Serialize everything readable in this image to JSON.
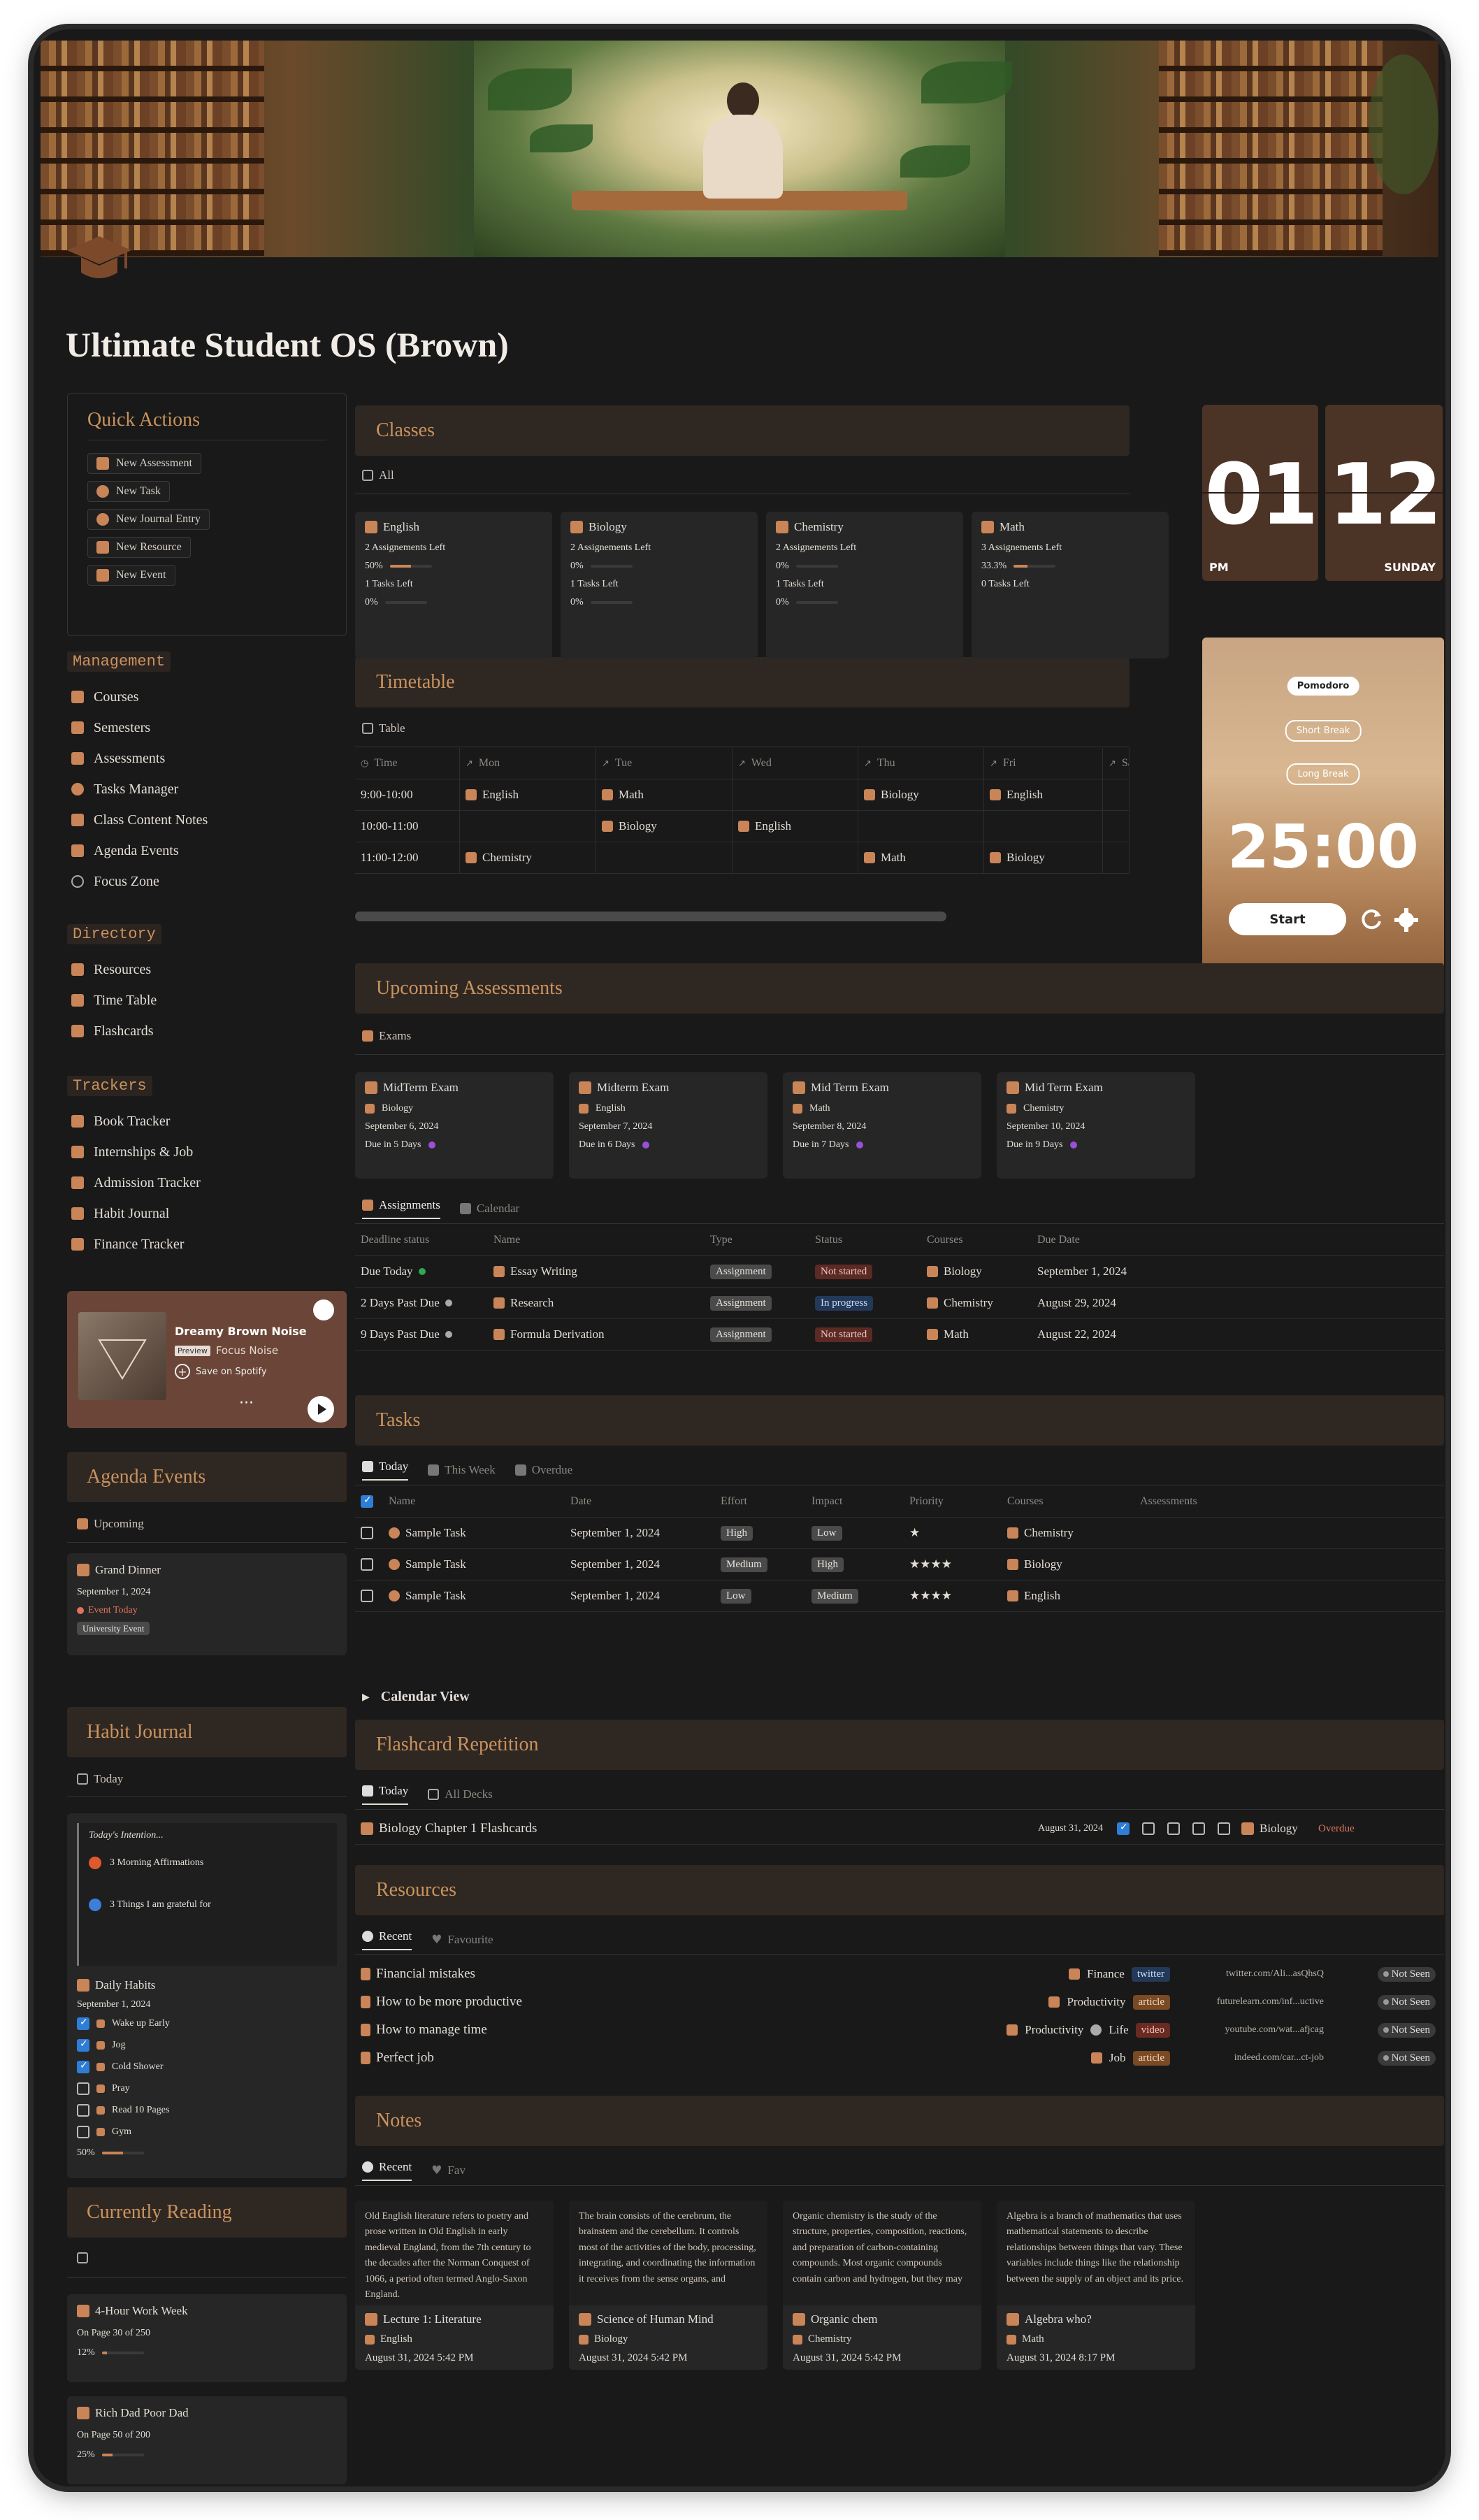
{
  "page_title": "Ultimate Student OS (Brown)",
  "quick_actions": {
    "title": "Quick Actions",
    "items": [
      "New Assessment",
      "New Task",
      "New Journal Entry",
      "New Resource",
      "New Event"
    ]
  },
  "management": {
    "title": "Management",
    "items": [
      "Courses",
      "Semesters",
      "Assessments",
      "Tasks Manager",
      "Class Content Notes",
      "Agenda Events",
      "Focus Zone"
    ]
  },
  "directory": {
    "title": "Directory",
    "items": [
      "Resources",
      "Time Table",
      "Flashcards"
    ]
  },
  "trackers": {
    "title": "Trackers",
    "items": [
      "Book Tracker",
      "Internships & Job",
      "Admission Tracker",
      "Habit Journal",
      "Finance Tracker"
    ]
  },
  "spotify": {
    "title": "Dreamy Brown Noise",
    "preview": "Preview",
    "subtitle": "Focus Noise",
    "save": "Save on Spotify",
    "more": "···"
  },
  "agenda": {
    "title": "Agenda Events",
    "view": "Upcoming",
    "event": {
      "name": "Grand Dinner",
      "date": "September 1, 2024",
      "status": "Event Today",
      "tag": "University Event"
    }
  },
  "habit": {
    "title": "Habit Journal",
    "view": "Today",
    "intention_title": "Today's Intention...",
    "intentions": [
      "3 Morning Affirmations",
      "3 Things I am grateful for"
    ],
    "daily_title": "Daily Habits",
    "date": "September 1, 2024",
    "items": [
      {
        "label": "Wake up Early",
        "done": true
      },
      {
        "label": "Jog",
        "done": true
      },
      {
        "label": "Cold Shower",
        "done": true
      },
      {
        "label": "Pray",
        "done": false
      },
      {
        "label": "Read 10 Pages",
        "done": false
      },
      {
        "label": "Gym",
        "done": false
      }
    ],
    "progress": "50%"
  },
  "reading": {
    "title": "Currently Reading",
    "books": [
      {
        "title": "4-Hour Work Week",
        "page": "On Page 30 of 250",
        "pct": "12%",
        "fill": 0.12
      },
      {
        "title": "Rich Dad Poor Dad",
        "page": "On Page 50 of 200",
        "pct": "25%",
        "fill": 0.25
      }
    ]
  },
  "classes": {
    "title": "Classes",
    "view": "All",
    "cards": [
      {
        "name": "English",
        "assign": "2 Assignements Left",
        "apct": "50%",
        "afill": 0.5,
        "tasks": "1 Tasks Left",
        "tpct": "0%"
      },
      {
        "name": "Biology",
        "assign": "2 Assignements Left",
        "apct": "0%",
        "afill": 0,
        "tasks": "1 Tasks Left",
        "tpct": "0%"
      },
      {
        "name": "Chemistry",
        "assign": "2 Assignements Left",
        "apct": "0%",
        "afill": 0,
        "tasks": "1 Tasks Left",
        "tpct": "0%"
      },
      {
        "name": "Math",
        "assign": "3 Assignements Left",
        "apct": "33.3%",
        "afill": 0.333,
        "tasks": "0 Tasks Left",
        "tpct": ""
      }
    ]
  },
  "clock": {
    "hour": "01",
    "minute": "12",
    "ampm": "PM",
    "day": "SUNDAY"
  },
  "pomodoro": {
    "modes": [
      "Pomodoro",
      "Short Break",
      "Long Break"
    ],
    "time": "25:00",
    "start": "Start"
  },
  "timetable": {
    "title": "Timetable",
    "view": "Table",
    "columns": [
      "Time",
      "Mon",
      "Tue",
      "Wed",
      "Thu",
      "Fri",
      "Sa"
    ],
    "rows": [
      [
        "9:00-10:00",
        "English",
        "Math",
        "",
        "Biology",
        "English",
        ""
      ],
      [
        "10:00-11:00",
        "",
        "Biology",
        "English",
        "",
        "",
        ""
      ],
      [
        "11:00-12:00",
        "Chemistry",
        "",
        "",
        "Math",
        "Biology",
        ""
      ]
    ]
  },
  "assessments": {
    "title": "Upcoming Assessments",
    "view": "Exams",
    "exams": [
      {
        "name": "MidTerm Exam",
        "course": "Biology",
        "date": "September 6, 2024",
        "due": "Due in 5 Days"
      },
      {
        "name": "Midterm Exam",
        "course": "English",
        "date": "September 7, 2024",
        "due": "Due in 6 Days"
      },
      {
        "name": "Mid Term Exam",
        "course": "Math",
        "date": "September 8, 2024",
        "due": "Due in 7 Days"
      },
      {
        "name": "Mid Term Exam",
        "course": "Chemistry",
        "date": "September 10, 2024",
        "due": "Due in 9 Days"
      }
    ],
    "tabs": [
      "Assignments",
      "Calendar"
    ],
    "columns": [
      "Deadline status",
      "Name",
      "Type",
      "Status",
      "Courses",
      "Due Date"
    ],
    "rows": [
      {
        "deadline": "Due Today",
        "name": "Essay Writing",
        "type": "Assignment",
        "status": "Not started",
        "course": "Biology",
        "due": "September 1, 2024"
      },
      {
        "deadline": "2 Days Past Due",
        "name": "Research",
        "type": "Assignment",
        "status": "In progress",
        "course": "Chemistry",
        "due": "August 29, 2024"
      },
      {
        "deadline": "9 Days Past Due",
        "name": "Formula Derivation",
        "type": "Assignment",
        "status": "Not started",
        "course": "Math",
        "due": "August 22, 2024"
      }
    ]
  },
  "tasks": {
    "title": "Tasks",
    "tabs": [
      "Today",
      "This Week",
      "Overdue"
    ],
    "columns": [
      "Name",
      "Date",
      "Effort",
      "Impact",
      "Priority",
      "Courses",
      "Assessments"
    ],
    "rows": [
      {
        "name": "Sample Task",
        "date": "September 1, 2024",
        "effort": "High",
        "impact": "Low",
        "priority": "★",
        "course": "Chemistry"
      },
      {
        "name": "Sample Task",
        "date": "September 1, 2024",
        "effort": "Medium",
        "impact": "High",
        "priority": "★★★★",
        "course": "Biology"
      },
      {
        "name": "Sample Task",
        "date": "September 1, 2024",
        "effort": "Low",
        "impact": "Medium",
        "priority": "★★★★",
        "course": "English"
      }
    ],
    "calendar_toggle": "Calendar View"
  },
  "flashcards": {
    "title": "Flashcard Repetition",
    "tabs": [
      "Today",
      "All Decks"
    ],
    "row": {
      "name": "Biology Chapter 1 Flashcards",
      "date": "August 31, 2024",
      "course": "Biology",
      "status": "Overdue"
    }
  },
  "resources": {
    "title": "Resources",
    "tabs": [
      "Recent",
      "Favourite"
    ],
    "rows": [
      {
        "name": "Financial mistakes",
        "cat": "Finance",
        "type": "twitter",
        "url": "twitter.com/Ali...asQhsQ",
        "status": "Not Seen"
      },
      {
        "name": "How to be more productive",
        "cat": "Productivity",
        "type": "article",
        "url": "futurelearn.com/inf...uctive",
        "status": "Not Seen"
      },
      {
        "name": "How to manage time",
        "cat": "Productivity",
        "cat2": "Life",
        "type": "video",
        "url": "youtube.com/wat...afjcag",
        "status": "Not Seen"
      },
      {
        "name": "Perfect job",
        "cat": "Job",
        "type": "article",
        "url": "indeed.com/car...ct-job",
        "status": "Not Seen"
      }
    ]
  },
  "notes": {
    "title": "Notes",
    "tabs": [
      "Recent",
      "Fav"
    ],
    "cards": [
      {
        "preview": "Old English literature refers to poetry and prose written in Old English in early medieval England, from the 7th century to the decades after the Norman Conquest of 1066, a period often termed Anglo-Saxon England.",
        "title": "Lecture 1: Literature",
        "course": "English",
        "date": "August 31, 2024 5:42 PM"
      },
      {
        "preview": "The brain consists of the cerebrum, the brainstem and the cerebellum. It controls most of the activities of the body, processing, integrating, and coordinating the information it receives from the sense organs, and",
        "title": "Science of Human Mind",
        "course": "Biology",
        "date": "August 31, 2024 5:42 PM"
      },
      {
        "preview": "Organic chemistry is the study of the structure, properties, composition, reactions, and preparation of carbon-containing compounds. Most organic compounds contain carbon and hydrogen, but they may",
        "title": "Organic chem",
        "course": "Chemistry",
        "date": "August 31, 2024 5:42 PM"
      },
      {
        "preview": "Algebra is a branch of mathematics that uses mathematical statements to describe relationships between things that vary. These variables include things like the relationship between the supply of an object and its price.",
        "title": "Algebra who?",
        "course": "Math",
        "date": "August 31, 2024 8:17 PM"
      }
    ]
  },
  "colors": {
    "accent": "#c9935e",
    "bg": "#191919",
    "card": "#262626",
    "header": "#2f2722"
  }
}
